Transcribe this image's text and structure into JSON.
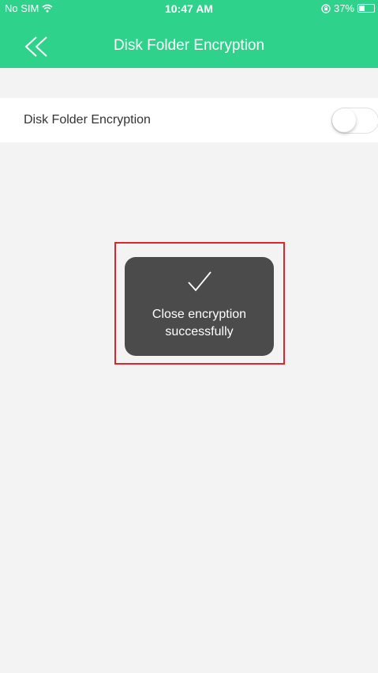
{
  "status_bar": {
    "carrier": "No SIM",
    "time": "10:47 AM",
    "battery": "37%",
    "battery_level": 0.37,
    "icons": [
      "wifi-icon",
      "lock-rotation-icon",
      "battery-icon"
    ]
  },
  "nav": {
    "back_icon": "double-chevron-left-icon",
    "title": "Disk Folder Encryption"
  },
  "settings": {
    "row_label": "Disk Folder Encryption",
    "toggle_state": "off"
  },
  "toast": {
    "icon": "checkmark-icon",
    "message": "Close encryption successfully"
  },
  "colors": {
    "header": "#2fd28b",
    "background": "#f3f3f3",
    "toast": "#4b4b4b",
    "highlight": "#e0242b"
  }
}
